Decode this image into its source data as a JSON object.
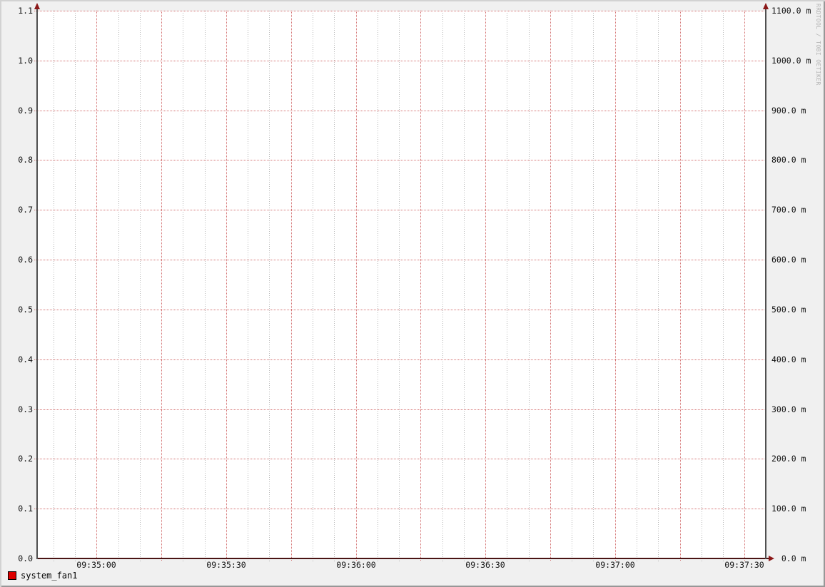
{
  "watermark": "RRDTOOL / TOBI OETIKER",
  "legend": {
    "swatch_color": "#dd0000",
    "label": "system_fan1"
  },
  "axes": {
    "y_left_labels": [
      "1.1",
      "1.0",
      "0.9",
      "0.8",
      "0.7",
      "0.6",
      "0.5",
      "0.4",
      "0.3",
      "0.2",
      "0.1",
      "0.0"
    ],
    "y_right_labels": [
      "1100.0 m",
      "1000.0 m",
      "900.0 m",
      "800.0 m",
      "700.0 m",
      "600.0 m",
      "500.0 m",
      "400.0 m",
      "300.0 m",
      "200.0 m",
      "100.0 m",
      "0.0 m"
    ],
    "x_labels": [
      "09:35:00",
      "09:35:30",
      "09:36:00",
      "09:36:30",
      "09:37:00",
      "09:37:30"
    ]
  },
  "colors": {
    "background": "#f0f0f0",
    "canvas": "#ffffff",
    "major_grid_red": "#cd5a5a",
    "minor_grid_gray": "#7d7d7d",
    "axis_gray": "#4f4f4f",
    "x_axis_maroon": "#4a1414",
    "arrow_dark_red": "#8b1818",
    "legend_red": "#dd0000",
    "watermark_gray": "#b2b2b2"
  },
  "chart_data": {
    "type": "line",
    "title": "",
    "xlabel": "",
    "ylabel": "",
    "x": [
      "09:35:00",
      "09:35:30",
      "09:36:00",
      "09:36:30",
      "09:37:00",
      "09:37:30"
    ],
    "series": [
      {
        "name": "system_fan1",
        "color": "#dd0000",
        "values": [
          0,
          0,
          0,
          0,
          0,
          0
        ]
      }
    ],
    "ylim_left": [
      0.0,
      1.1
    ],
    "y_left_tick_step": 0.1,
    "y_right_tick_labels_unit": "m",
    "ylim_right_milli": [
      0.0,
      1100.0
    ],
    "y_right_tick_step_milli": 100.0,
    "x_minor_grid_seconds": 5,
    "x_major_grid_seconds": 15,
    "x_label_interval_seconds": 30,
    "grid": true,
    "legend_position": "bottom-left",
    "watermark": "RRDTOOL / TOBI OETIKER"
  }
}
